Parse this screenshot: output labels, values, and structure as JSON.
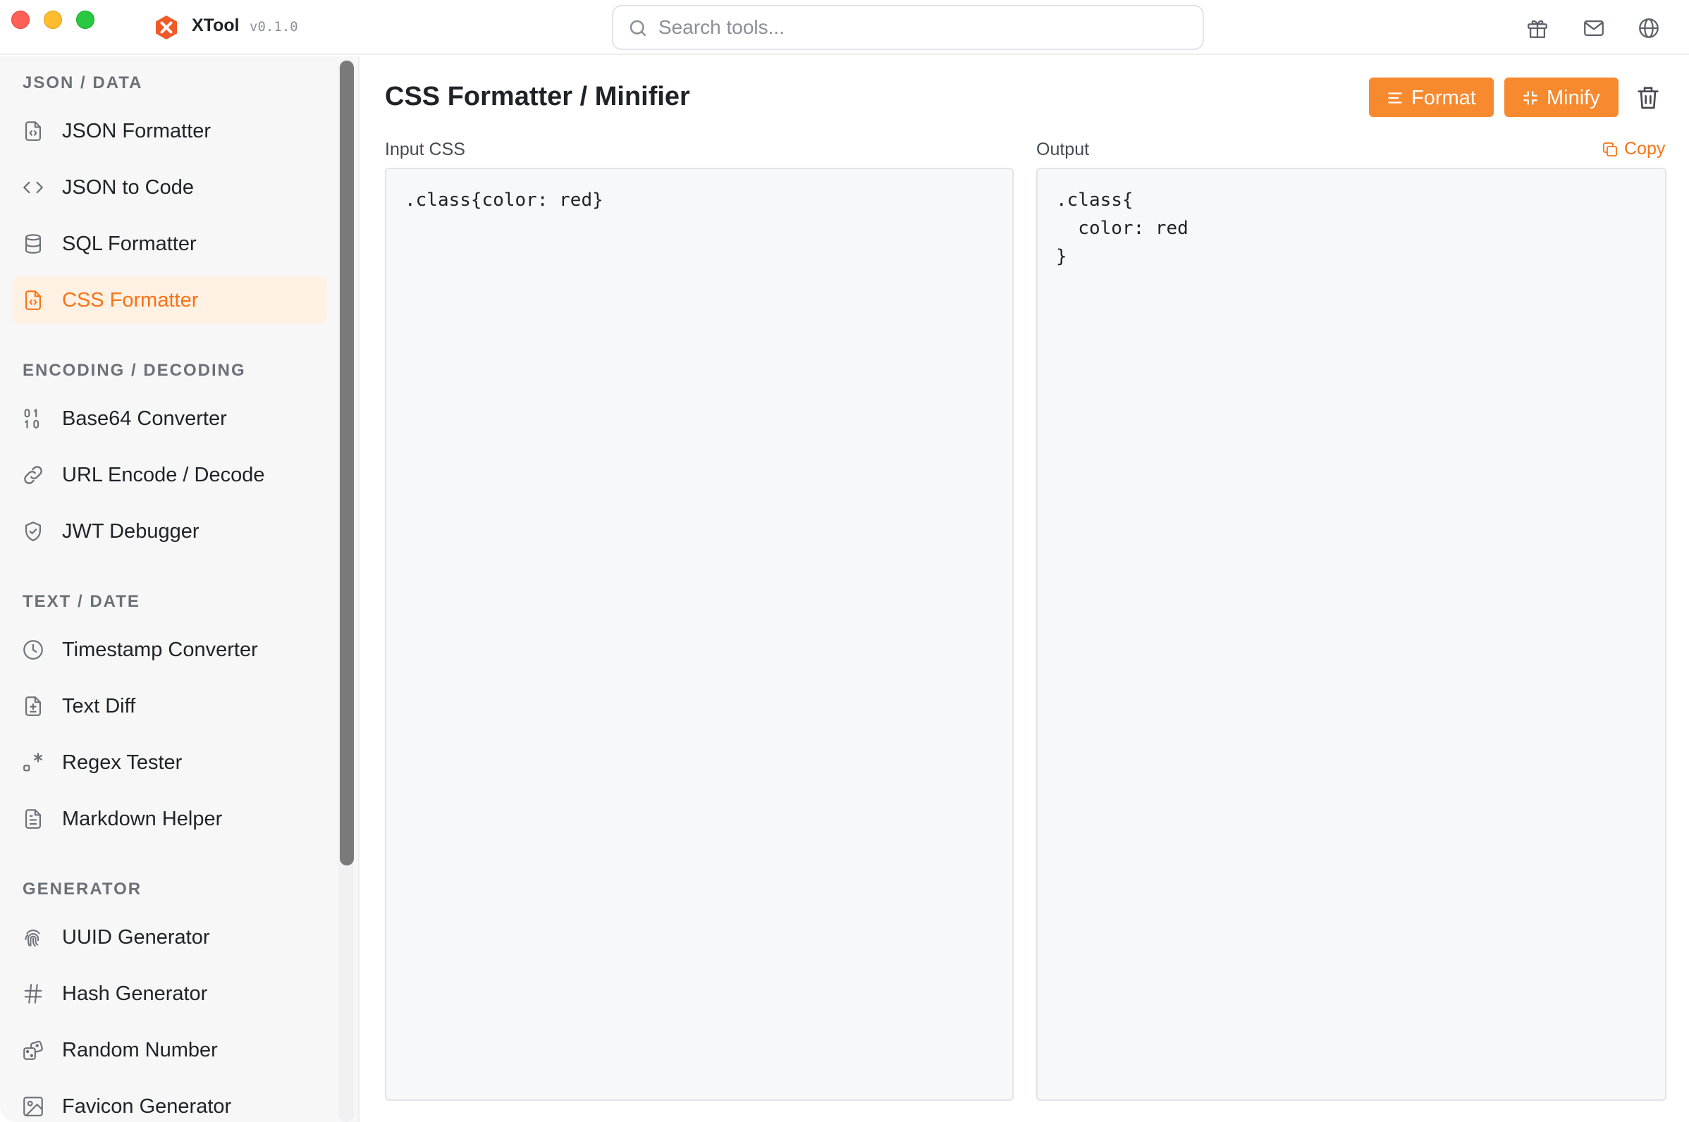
{
  "app": {
    "name": "XTool",
    "version": "v0.1.0",
    "accent_color": "#f97316",
    "brand_color": "#f05a28"
  },
  "search": {
    "placeholder": "Search tools...",
    "value": ""
  },
  "titlebar_icons": [
    "gift-icon",
    "mail-icon",
    "globe-icon"
  ],
  "sidebar": {
    "sections": [
      {
        "title": "JSON / DATA",
        "items": [
          {
            "label": "JSON Formatter",
            "icon": "file-code-icon"
          },
          {
            "label": "JSON to Code",
            "icon": "code-brackets-icon"
          },
          {
            "label": "SQL Formatter",
            "icon": "database-icon"
          },
          {
            "label": "CSS Formatter",
            "icon": "file-code-icon",
            "active": true
          }
        ]
      },
      {
        "title": "ENCODING / DECODING",
        "items": [
          {
            "label": "Base64 Converter",
            "icon": "binary-icon"
          },
          {
            "label": "URL Encode / Decode",
            "icon": "link-icon"
          },
          {
            "label": "JWT Debugger",
            "icon": "shield-check-icon"
          }
        ]
      },
      {
        "title": "TEXT / DATE",
        "items": [
          {
            "label": "Timestamp Converter",
            "icon": "clock-icon"
          },
          {
            "label": "Text Diff",
            "icon": "file-diff-icon"
          },
          {
            "label": "Regex Tester",
            "icon": "regex-icon"
          },
          {
            "label": "Markdown Helper",
            "icon": "file-text-icon"
          }
        ]
      },
      {
        "title": "GENERATOR",
        "items": [
          {
            "label": "UUID Generator",
            "icon": "fingerprint-icon"
          },
          {
            "label": "Hash Generator",
            "icon": "hash-icon"
          },
          {
            "label": "Random Number",
            "icon": "dice-icon"
          },
          {
            "label": "Favicon Generator",
            "icon": "image-icon"
          }
        ]
      }
    ]
  },
  "main": {
    "title": "CSS Formatter / Minifier",
    "format_label": "Format",
    "minify_label": "Minify",
    "input_label": "Input CSS",
    "output_label": "Output",
    "copy_label": "Copy",
    "input_value": ".class{color: red}",
    "output_value": ".class{\n  color: red\n}"
  }
}
